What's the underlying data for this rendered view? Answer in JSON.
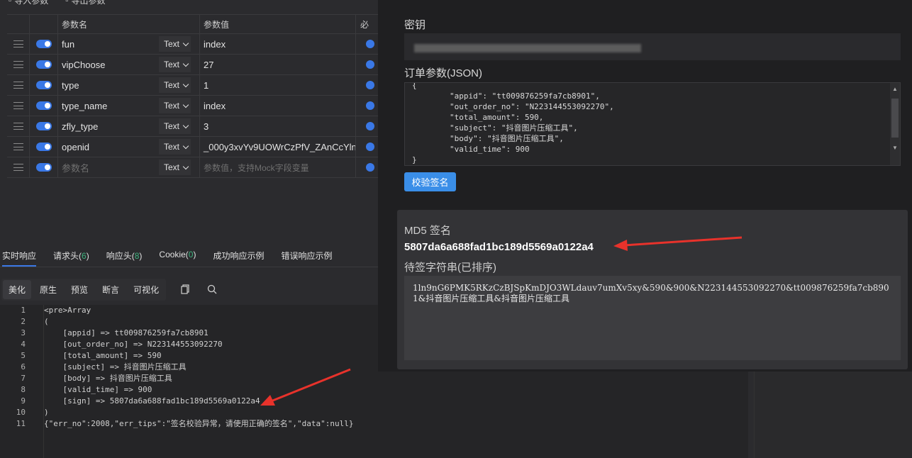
{
  "toolbar": {
    "import_label": "导入参数",
    "export_label": "导出参数"
  },
  "params": {
    "header": {
      "name": "参数名",
      "value": "参数值",
      "required": "必"
    },
    "rows": [
      {
        "name": "fun",
        "type": "Text",
        "value": "index"
      },
      {
        "name": "vipChoose",
        "type": "Text",
        "value": "27"
      },
      {
        "name": "type",
        "type": "Text",
        "value": "1"
      },
      {
        "name": "type_name",
        "type": "Text",
        "value": "index"
      },
      {
        "name": "zfly_type",
        "type": "Text",
        "value": "3"
      },
      {
        "name": "openid",
        "type": "Text",
        "value": "_000y3xvYv9UOWrCzPfV_ZAnCcYln"
      }
    ],
    "new_row": {
      "name_placeholder": "参数名",
      "type": "Text",
      "value_placeholder": "参数值，支持Mock字段变量"
    }
  },
  "response_tabs": [
    {
      "label": "实时响应",
      "count": ""
    },
    {
      "label": "请求头",
      "count": "6"
    },
    {
      "label": "响应头",
      "count": "8"
    },
    {
      "label": "Cookie",
      "count": "0"
    },
    {
      "label": "成功响应示例",
      "count": ""
    },
    {
      "label": "错误响应示例",
      "count": ""
    }
  ],
  "view_tabs": [
    "美化",
    "原生",
    "预览",
    "断言",
    "可视化"
  ],
  "code_lines": [
    {
      "n": "1",
      "text": "<pre>Array"
    },
    {
      "n": "2",
      "text": "("
    },
    {
      "n": "3",
      "text": "    [appid] => tt009876259fa7cb8901"
    },
    {
      "n": "4",
      "text": "    [out_order_no] => N223144553092270"
    },
    {
      "n": "5",
      "text": "    [total_amount] => 590"
    },
    {
      "n": "6",
      "text": "    [subject] => 抖音图片压缩工具"
    },
    {
      "n": "7",
      "text": "    [body] => 抖音图片压缩工具"
    },
    {
      "n": "8",
      "text": "    [valid_time] => 900"
    },
    {
      "n": "9",
      "text": "    [sign] => 5807da6a688fad1bc189d5569a0122a4"
    },
    {
      "n": "10",
      "text": ")"
    },
    {
      "n": "11",
      "text": "{\"err_no\":2008,\"err_tips\":\"签名校验异常，请使用正确的签名\",\"data\":null}"
    }
  ],
  "signer": {
    "secret_label": "密钥",
    "order_label": "订单参数(JSON)",
    "order_json": "{\n        \"appid\": \"tt009876259fa7cb8901\",\n        \"out_order_no\": \"N223144553092270\",\n        \"total_amount\": 590,\n        \"subject\": \"抖音图片压缩工具\",\n        \"body\": \"抖音图片压缩工具\",\n        \"valid_time\": 900\n}",
    "verify_button": "校验签名",
    "md5_label": "MD5 签名",
    "md5_value": "5807da6a688fad1bc189d5569a0122a4",
    "pending_label": "待签字符串(已排序)",
    "pending_value": "1ln9nG6PMK5RKzCzBJSpKmDJO3WLdauv7umXv5xy&590&900&N223144553092270&tt009876259fa7cb8901&抖音图片压缩工具&抖音图片压缩工具"
  },
  "colors": {
    "accent": "#3a78e6",
    "button": "#3a8ee8",
    "count": "#3fb27f",
    "annotation_arrow": "#e8322b"
  }
}
